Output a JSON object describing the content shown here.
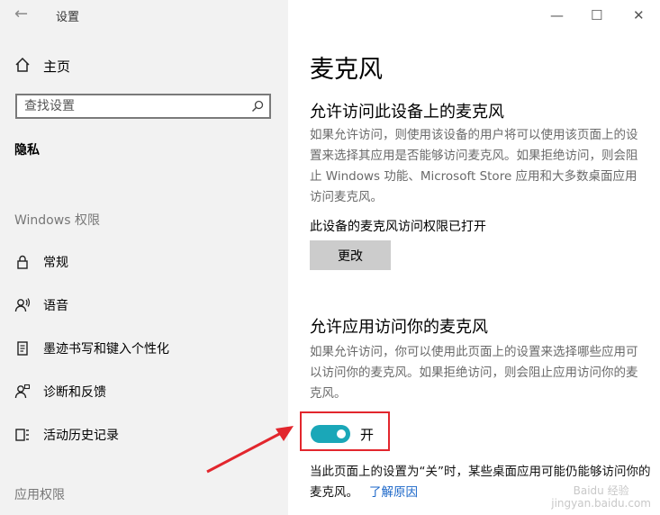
{
  "app": {
    "title": "设置",
    "back_icon": "arrow-left-icon"
  },
  "window_controls": {
    "minimize": "—",
    "maximize": "☐",
    "close": "✕"
  },
  "sidebar": {
    "home": {
      "label": "主页",
      "icon": "home-icon"
    },
    "search": {
      "placeholder": "查找设置",
      "icon": "search-icon"
    },
    "category": "隐私",
    "sections": [
      {
        "title": "Windows 权限"
      },
      {
        "title": "应用权限"
      }
    ],
    "items": [
      {
        "label": "常规",
        "icon": "lock-icon"
      },
      {
        "label": "语音",
        "icon": "speech-icon"
      },
      {
        "label": "墨迹书写和键入个性化",
        "icon": "ink-icon"
      },
      {
        "label": "诊断和反馈",
        "icon": "feedback-icon"
      },
      {
        "label": "活动历史记录",
        "icon": "activity-history-icon"
      }
    ]
  },
  "main": {
    "title": "麦克风",
    "device_section": {
      "heading": "允许访问此设备上的麦克风",
      "description": "如果允许访问，则使用该设备的用户将可以使用该页面上的设置来选择其应用是否能够访问麦克风。如果拒绝访问，则会阻止 Windows 功能、Microsoft Store 应用和大多数桌面应用访问麦克风。",
      "status": "此设备的麦克风访问权限已打开",
      "change_button": "更改"
    },
    "app_section": {
      "heading": "允许应用访问你的麦克风",
      "description": "如果允许访问，你可以使用此页面上的设置来选择哪些应用可以访问你的麦克风。如果拒绝访问，则会阻止应用访问你的麦克风。",
      "toggle_state": "开",
      "toggle_on": true,
      "note": "当此页面上的设置为“关”时，某些桌面应用可能仍能够访问你的麦克风。",
      "link": "了解原因"
    }
  },
  "annotation": {
    "highlight_color": "#e2262d",
    "arrow_color": "#e2262d"
  },
  "accent_color": "#1aa7b8",
  "watermark": {
    "line1": "Baidu 经验",
    "line2": "jingyan.baidu.com"
  }
}
